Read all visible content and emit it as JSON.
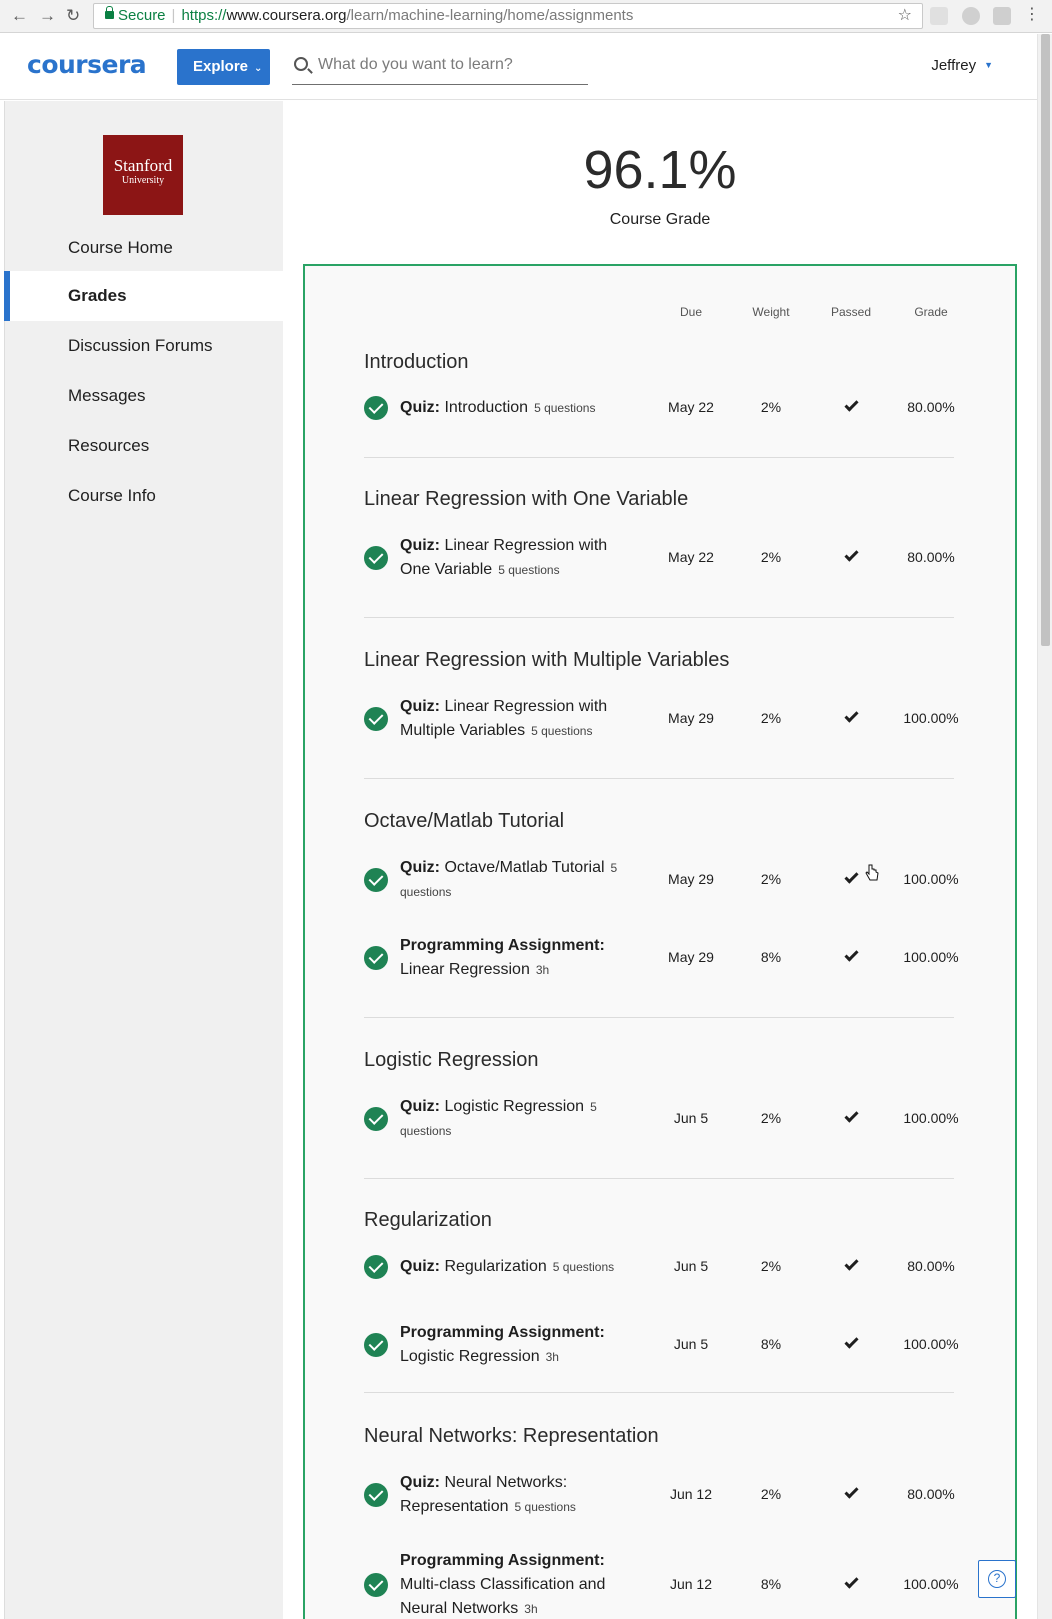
{
  "browser": {
    "secure_label": "Secure",
    "url_scheme": "https://",
    "url_host": "www.coursera.org",
    "url_path": "/learn/machine-learning/home/assignments"
  },
  "header": {
    "logo": "coursera",
    "explore_label": "Explore",
    "search_placeholder": "What do you want to learn?",
    "user_name": "Jeffrey"
  },
  "sidebar": {
    "university_line1": "Stanford",
    "university_line2": "University",
    "items": [
      {
        "label": "Course Home"
      },
      {
        "label": "Grades",
        "active": true
      },
      {
        "label": "Discussion Forums"
      },
      {
        "label": "Messages"
      },
      {
        "label": "Resources"
      },
      {
        "label": "Course Info"
      }
    ]
  },
  "grade": {
    "value": "96.1%",
    "caption": "Course Grade"
  },
  "table": {
    "headers": [
      "Due",
      "Weight",
      "Passed",
      "Grade"
    ],
    "weeks": [
      {
        "title": "Introduction",
        "items": [
          {
            "type": "Quiz:",
            "name": "Introduction",
            "meta": "5 questions",
            "due": "May 22",
            "weight": "2%",
            "grade": "80.00%"
          }
        ]
      },
      {
        "title": "Linear Regression with One Variable",
        "items": [
          {
            "type": "Quiz:",
            "name": "Linear Regression with One Variable",
            "meta": "5 questions",
            "due": "May 22",
            "weight": "2%",
            "grade": "80.00%"
          }
        ]
      },
      {
        "title": "Linear Regression with Multiple Variables",
        "items": [
          {
            "type": "Quiz:",
            "name": "Linear Regression with Multiple Variables",
            "meta": "5 questions",
            "due": "May 29",
            "weight": "2%",
            "grade": "100.00%"
          }
        ]
      },
      {
        "title": "Octave/Matlab Tutorial",
        "items": [
          {
            "type": "Quiz:",
            "name": "Octave/Matlab Tutorial",
            "meta": "5 questions",
            "due": "May 29",
            "weight": "2%",
            "grade": "100.00%"
          },
          {
            "type": "Programming Assignment:",
            "name": "Linear Regression",
            "meta": "3h",
            "due": "May 29",
            "weight": "8%",
            "grade": "100.00%"
          }
        ]
      },
      {
        "title": "Logistic Regression",
        "items": [
          {
            "type": "Quiz:",
            "name": "Logistic Regression",
            "meta": "5 questions",
            "due": "Jun 5",
            "weight": "2%",
            "grade": "100.00%"
          }
        ]
      },
      {
        "title": "Regularization",
        "items": [
          {
            "type": "Quiz:",
            "name": "Regularization",
            "meta": "5 questions",
            "due": "Jun 5",
            "weight": "2%",
            "grade": "80.00%"
          },
          {
            "type": "Programming Assignment:",
            "name": "Logistic Regression",
            "meta": "3h",
            "due": "Jun 5",
            "weight": "8%",
            "grade": "100.00%"
          }
        ]
      },
      {
        "title": "Neural Networks: Representation",
        "items": [
          {
            "type": "Quiz:",
            "name": "Neural Networks: Representation",
            "meta": "5 questions",
            "due": "Jun 12",
            "weight": "2%",
            "grade": "80.00%"
          },
          {
            "type": "Programming Assignment:",
            "name": "Multi-class Classification and Neural Networks",
            "meta": "3h",
            "due": "Jun 12",
            "weight": "8%",
            "grade": "100.00%"
          }
        ]
      }
    ]
  },
  "help_label": "?"
}
